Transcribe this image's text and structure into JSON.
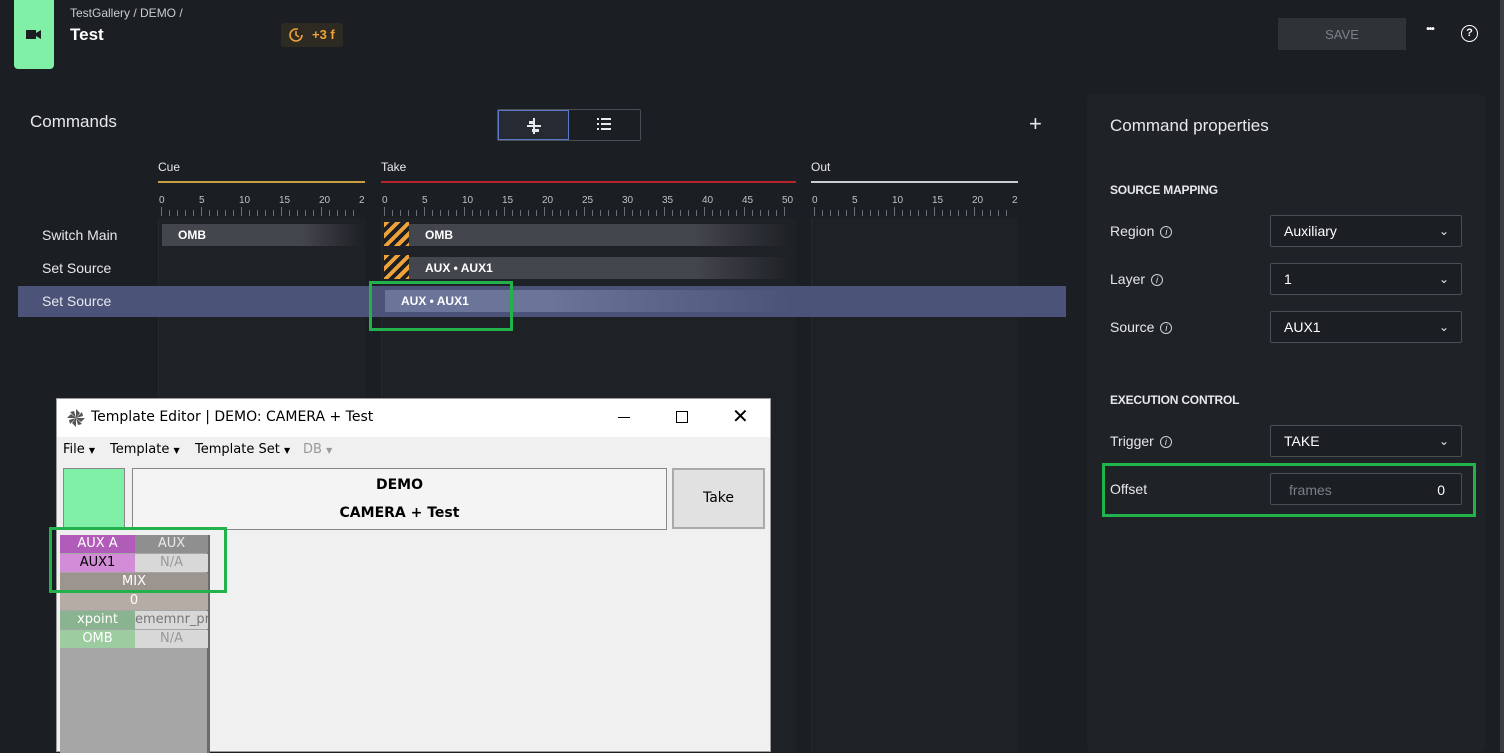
{
  "header": {
    "breadcrumb": "TestGallery / DEMO /",
    "title": "Test",
    "offset_badge": "+3 f",
    "save_label": "SAVE",
    "more_label": "•••",
    "help_label": "?"
  },
  "commands": {
    "title": "Commands",
    "add_label": "+",
    "phases": [
      {
        "label": "Cue",
        "color": "#c8a040",
        "ticks": [
          "0",
          "5",
          "10",
          "15",
          "20",
          "2"
        ]
      },
      {
        "label": "Take",
        "color": "#b8242c",
        "ticks": [
          "0",
          "5",
          "10",
          "15",
          "20",
          "25",
          "30",
          "35",
          "40",
          "45",
          "50"
        ]
      },
      {
        "label": "Out",
        "color": "#c9ccd1",
        "ticks": [
          "0",
          "5",
          "10",
          "15",
          "20",
          "2"
        ]
      }
    ],
    "rows": [
      {
        "label": "Switch Main",
        "cue_block": "OMB",
        "take_block": "OMB"
      },
      {
        "label": "Set Source",
        "take_block": "AUX • AUX1"
      },
      {
        "label": "Set Source",
        "take_block": "AUX • AUX1",
        "selected": true
      }
    ]
  },
  "properties": {
    "title": "Command properties",
    "source_mapping": "SOURCE MAPPING",
    "region": {
      "label": "Region",
      "value": "Auxiliary"
    },
    "layer": {
      "label": "Layer",
      "value": "1"
    },
    "source": {
      "label": "Source",
      "value": "AUX1"
    },
    "execution_control": "EXECUTION CONTROL",
    "trigger": {
      "label": "Trigger",
      "value": "TAKE"
    },
    "offset": {
      "label": "Offset",
      "placeholder": "frames",
      "value": "0"
    }
  },
  "template_editor": {
    "title": "Template Editor | DEMO: CAMERA + Test",
    "menus": [
      "File",
      "Template",
      "Template Set",
      "DB"
    ],
    "header_line1": "DEMO",
    "header_line2": "CAMERA + Test",
    "take_label": "Take",
    "cells": {
      "aux_a": "AUX A",
      "aux": "AUX",
      "aux1": "AUX1",
      "na1": "N/A",
      "mix": "MIX",
      "zero": "0",
      "xpoint": "xpoint",
      "ememnr": "ememnr_pr",
      "omb": "OMB",
      "na2": "N/A"
    }
  },
  "colors": {
    "accent_green": "#7ff0a6",
    "selection": "#4b5379",
    "highlight_box": "#22b24c",
    "warning_orange": "#f0a23a"
  }
}
